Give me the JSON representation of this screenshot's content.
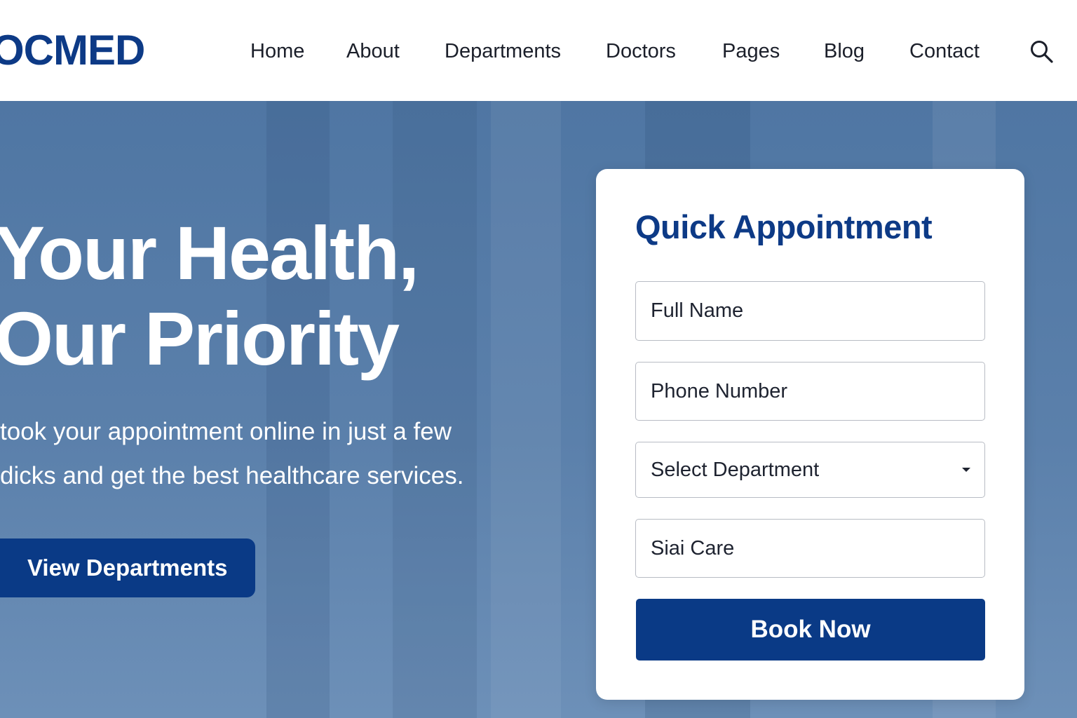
{
  "brand": {
    "logo_text": "OCMED",
    "color": "#0d3a86"
  },
  "nav": {
    "items": [
      {
        "label": "Home"
      },
      {
        "label": "About"
      },
      {
        "label": "Departments"
      },
      {
        "label": "Doctors"
      },
      {
        "label": "Pages"
      },
      {
        "label": "Blog"
      },
      {
        "label": "Contact"
      }
    ],
    "search_icon": "search-icon"
  },
  "hero": {
    "headline_line1": "Your Health,",
    "headline_line2": "Our Priority",
    "subtext_line1": "took your appointment online in just a few",
    "subtext_line2": "dicks and get the best healthcare services.",
    "cta_label": "View Departments"
  },
  "appointment": {
    "title": "Quick Appointment",
    "full_name_placeholder": "Full Name",
    "phone_placeholder": "Phone Number",
    "department_selected": "Select Department",
    "care_value": "Siai Care",
    "submit_label": "Book Now"
  },
  "colors": {
    "primary": "#0a3a86",
    "hero_overlay": "#5b80ab"
  }
}
